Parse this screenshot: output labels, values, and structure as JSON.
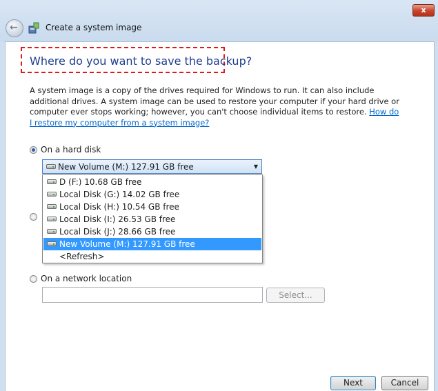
{
  "window": {
    "title": "Create a system image",
    "close_glyph": "x",
    "back_glyph": "←"
  },
  "page": {
    "heading": "Where do you want to save the backup?",
    "description": "A system image is a copy of the drives required for Windows to run. It can also include additional drives. A system image can be used to restore your computer if your hard drive or computer ever stops working; however, you can't choose individual items to restore.",
    "help_link": "How do I restore my computer from a system image?"
  },
  "options": {
    "hard_disk": {
      "label": "On a hard disk",
      "selected": true,
      "combo_value": "New Volume (M:)  127.91 GB free",
      "dropdown_items": [
        {
          "label": "D (F:)  10.68 GB free",
          "icon": "drive-icon"
        },
        {
          "label": "Local Disk (G:)  14.02 GB free",
          "icon": "drive-icon"
        },
        {
          "label": "Local Disk (H:)  10.54 GB free",
          "icon": "drive-icon"
        },
        {
          "label": "Local Disk (I:)  26.53 GB free",
          "icon": "drive-icon"
        },
        {
          "label": "Local Disk (J:)  28.66 GB free",
          "icon": "drive-icon"
        },
        {
          "label": "New Volume (M:)  127.91 GB free",
          "icon": "drive-icon",
          "selected": true
        },
        {
          "label": "<Refresh>"
        }
      ]
    },
    "network": {
      "label": "On a network location",
      "selected": false,
      "input_value": "",
      "select_button": "Select..."
    }
  },
  "footer": {
    "next": "Next",
    "cancel": "Cancel"
  },
  "colors": {
    "heading": "#1e3d8f",
    "highlight_box": "#e0191d",
    "selection": "#3399ff",
    "link": "#0066cc"
  }
}
